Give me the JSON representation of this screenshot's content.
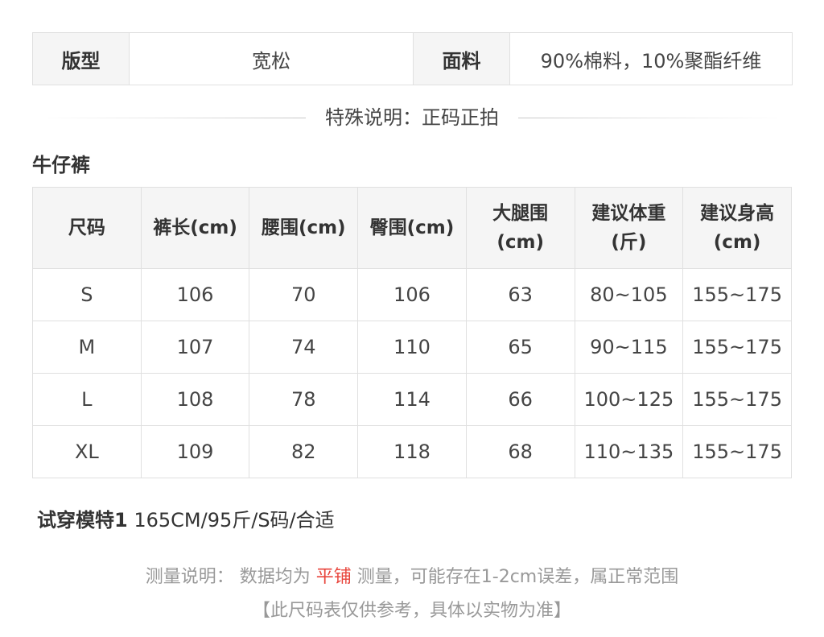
{
  "attributes": {
    "fit_label": "版型",
    "fit_value": "宽松",
    "fabric_label": "面料",
    "fabric_value": "90%棉料，10%聚酯纤维"
  },
  "special_note": "特殊说明：正码正拍",
  "section_title": "牛仔裤",
  "size_table": {
    "headers": [
      {
        "line1": "尺码",
        "line2": ""
      },
      {
        "line1": "裤长(cm)",
        "line2": ""
      },
      {
        "line1": "腰围(cm)",
        "line2": ""
      },
      {
        "line1": "臀围(cm)",
        "line2": ""
      },
      {
        "line1": "大腿围",
        "line2": "(cm)"
      },
      {
        "line1": "建议体重",
        "line2": "(斤)"
      },
      {
        "line1": "建议身高",
        "line2": "(cm)"
      }
    ],
    "rows": [
      [
        "S",
        "106",
        "70",
        "106",
        "63",
        "80~105",
        "155~175"
      ],
      [
        "M",
        "107",
        "74",
        "110",
        "65",
        "90~115",
        "155~175"
      ],
      [
        "L",
        "108",
        "78",
        "114",
        "66",
        "100~125",
        "155~175"
      ],
      [
        "XL",
        "109",
        "82",
        "118",
        "68",
        "110~135",
        "155~175"
      ]
    ]
  },
  "model": {
    "label": "试穿模特1",
    "info": " 165CM/95斤/S码/合适"
  },
  "measurement_note": {
    "prefix": "测量说明： 数据均为 ",
    "highlight": "平铺",
    "suffix": " 测量，可能存在1-2cm误差，属正常范围",
    "highlight_color": "#e8453c"
  },
  "disclaimer": "【此尺码表仅供参考，具体以实物为准】"
}
